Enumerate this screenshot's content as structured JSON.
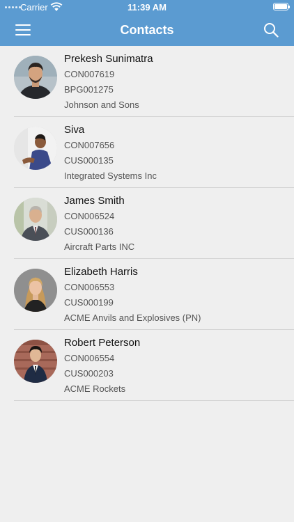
{
  "status_bar": {
    "carrier": "Carrier",
    "time": "11:39 AM"
  },
  "nav": {
    "title": "Contacts",
    "menu_icon": "hamburger-menu-icon",
    "search_icon": "search-icon"
  },
  "colors": {
    "header": "#5b9bd1",
    "background": "#efefef",
    "divider": "#d4d4d4"
  },
  "contacts": [
    {
      "name": "Prekesh Sunimatra",
      "contact_id": "CON007619",
      "account_id": "BPG001275",
      "company": "Johnson and Sons"
    },
    {
      "name": "Siva",
      "contact_id": "CON007656",
      "account_id": "CUS000135",
      "company": "Integrated Systems Inc"
    },
    {
      "name": "James Smith",
      "contact_id": "CON006524",
      "account_id": "CUS000136",
      "company": "Aircraft Parts INC"
    },
    {
      "name": "Elizabeth Harris",
      "contact_id": "CON006553",
      "account_id": "CUS000199",
      "company": "ACME Anvils and Explosives (PN)"
    },
    {
      "name": "Robert Peterson",
      "contact_id": "CON006554",
      "account_id": "CUS000203",
      "company": "ACME Rockets"
    }
  ]
}
